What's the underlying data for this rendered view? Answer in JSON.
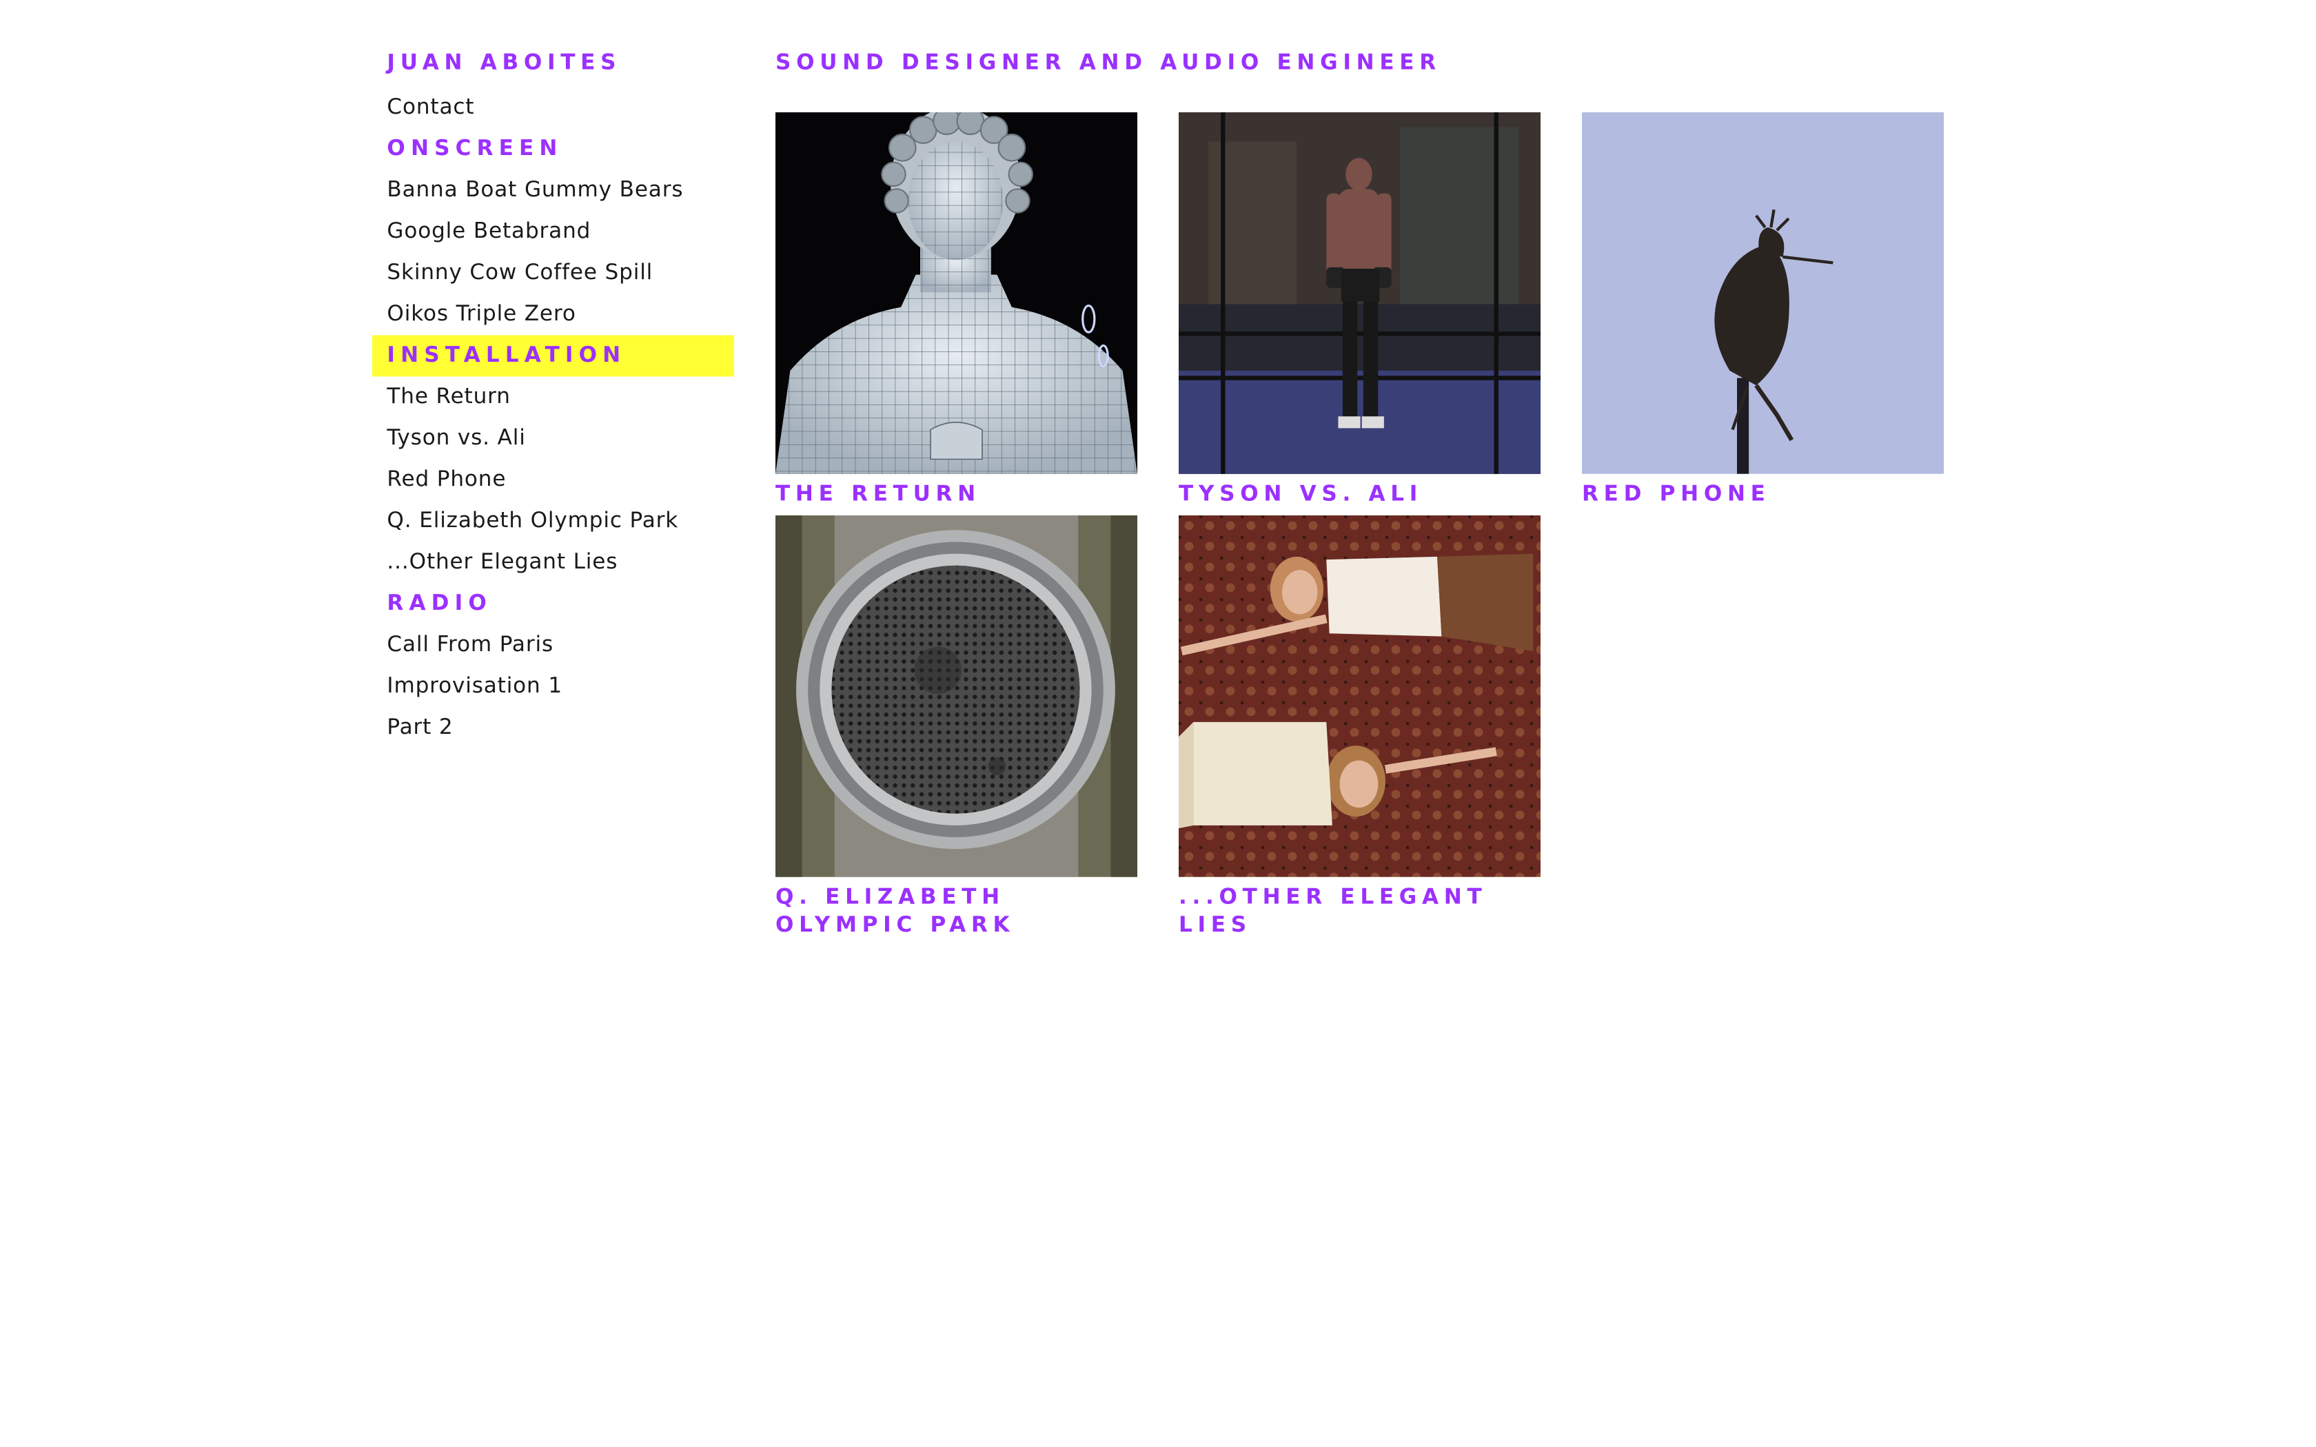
{
  "site": {
    "name": "JUAN ABOITES",
    "tagline": "SOUND DESIGNER AND AUDIO ENGINEER"
  },
  "sidebar": {
    "contact_label": "Contact",
    "sections": [
      {
        "label": "ONSCREEN",
        "items": [
          "Banna Boat Gummy Bears",
          "Google Betabrand",
          "Skinny Cow Coffee Spill",
          "Oikos Triple Zero"
        ]
      },
      {
        "label": "INSTALLATION",
        "active": true,
        "items": [
          "The Return",
          "Tyson vs. Ali",
          "Red Phone",
          "Q. Elizabeth Olympic Park",
          "...Other Elegant Lies"
        ]
      },
      {
        "label": "RADIO",
        "items": [
          "Call From Paris",
          "Improvisation 1",
          "Part 2"
        ]
      }
    ]
  },
  "gallery": {
    "items": [
      {
        "title": "THE RETURN",
        "image": "wireframe-statue-image"
      },
      {
        "title": "TYSON VS. ALI",
        "image": "boxer-in-ring-image"
      },
      {
        "title": "RED PHONE",
        "image": "bird-on-post-image"
      },
      {
        "title": "Q. ELIZABETH OLYMPIC PARK",
        "image": "metal-speaker-grille-image"
      },
      {
        "title": "...OTHER ELEGANT LIES",
        "image": "two-women-on-rug-image"
      }
    ]
  },
  "colors": {
    "accent": "#9b30ff",
    "highlight": "#ffff33",
    "text": "#1a1a1a",
    "background": "#ffffff"
  }
}
